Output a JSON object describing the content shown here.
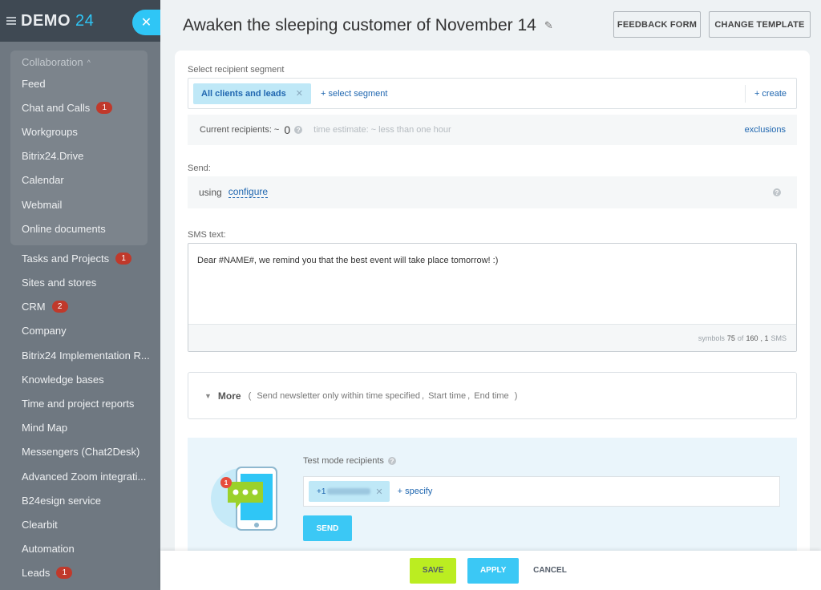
{
  "sidebar": {
    "logo_text": "DEMO",
    "logo_number": "24",
    "group_title": "Collaboration",
    "group_items": [
      {
        "label": "Feed",
        "badge": ""
      },
      {
        "label": "Chat and Calls",
        "badge": "1"
      },
      {
        "label": "Workgroups",
        "badge": ""
      },
      {
        "label": "Bitrix24.Drive",
        "badge": ""
      },
      {
        "label": "Calendar",
        "badge": ""
      },
      {
        "label": "Webmail",
        "badge": ""
      },
      {
        "label": "Online documents",
        "badge": ""
      }
    ],
    "items": [
      {
        "label": "Tasks and Projects",
        "badge": "1"
      },
      {
        "label": "Sites and stores",
        "badge": ""
      },
      {
        "label": "CRM",
        "badge": "2"
      },
      {
        "label": "Company",
        "badge": ""
      },
      {
        "label": "Bitrix24 Implementation R...",
        "badge": ""
      },
      {
        "label": "Knowledge bases",
        "badge": ""
      },
      {
        "label": "Time and project reports",
        "badge": ""
      },
      {
        "label": "Mind Map",
        "badge": ""
      },
      {
        "label": "Messengers (Chat2Desk)",
        "badge": ""
      },
      {
        "label": "Advanced Zoom integrati...",
        "badge": ""
      },
      {
        "label": "B24esign service",
        "badge": ""
      },
      {
        "label": "Clearbit",
        "badge": ""
      },
      {
        "label": "Automation",
        "badge": ""
      },
      {
        "label": "Leads",
        "badge": "1"
      }
    ]
  },
  "header": {
    "title": "Awaken the sleeping customer of November 14",
    "feedback_button": "FEEDBACK FORM",
    "template_button": "CHANGE TEMPLATE"
  },
  "segment": {
    "label": "Select recipient segment",
    "chip": "All clients and leads",
    "select_link": "+ select segment",
    "create_link": "+ create"
  },
  "recipients": {
    "label": "Current recipients: ~",
    "count": "0",
    "estimate": "time estimate: ~ less than one hour",
    "exclusions": "exclusions"
  },
  "send": {
    "label": "Send:",
    "using": "using",
    "configure": "configure"
  },
  "sms": {
    "label": "SMS text:",
    "text": "Dear #NAME#, we remind you that the best event will take place tomorrow! :)",
    "symbols_label": "symbols",
    "symbols_count": "75",
    "of_label": "of",
    "symbols_max": "160",
    "sms_count": ", 1",
    "sms_label": "SMS"
  },
  "more": {
    "label": "More",
    "options_open": "(",
    "option_1": "Send newsletter only within time specified",
    "option_2": "Start time",
    "option_3": "End time",
    "options_close": ")"
  },
  "test": {
    "label": "Test mode recipients",
    "phone_prefix": "+1",
    "specify": "+ specify",
    "send_button": "SEND",
    "notification_count": "1"
  },
  "footer": {
    "save": "SAVE",
    "apply": "APPLY",
    "cancel": "CANCEL"
  }
}
